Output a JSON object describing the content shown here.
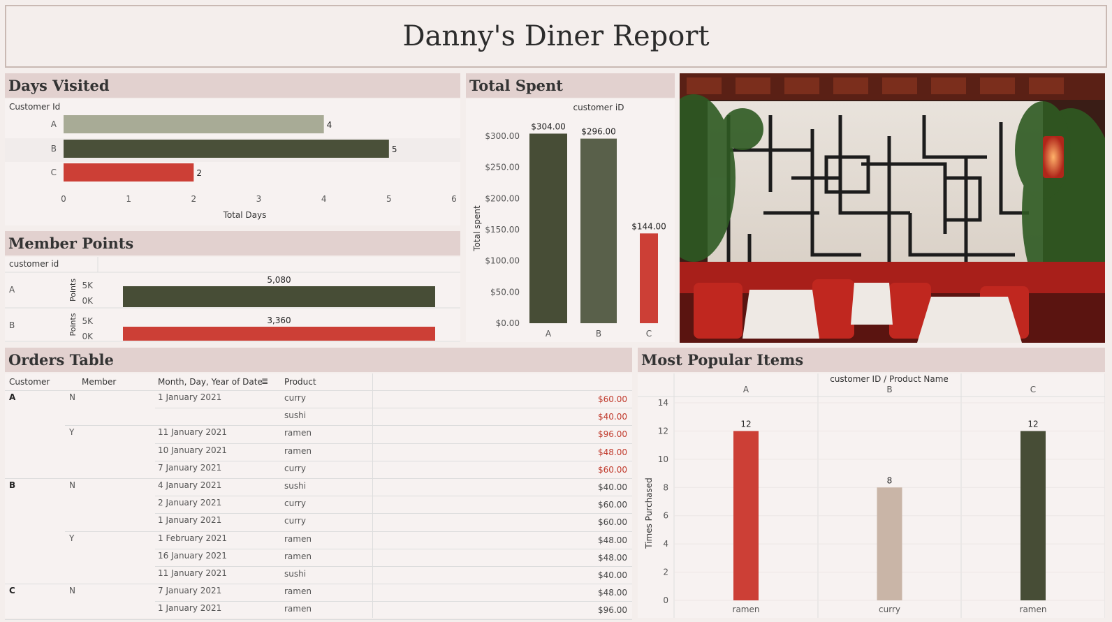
{
  "title": "Danny's Diner Report",
  "days_visited": {
    "header": "Days Visited",
    "row_header": "Customer Id",
    "xlabel": "Total Days",
    "xticks": [
      "0",
      "1",
      "2",
      "3",
      "4",
      "5",
      "6"
    ],
    "colors": [
      "#a8ab96",
      "#4a5039",
      "#cc3f36"
    ]
  },
  "total_spent": {
    "header": "Total Spent",
    "top_label": "customer iD",
    "ylabel": "Total spent",
    "yticks": [
      "$0.00",
      "$50.00",
      "$100.00",
      "$150.00",
      "$200.00",
      "$250.00",
      "$300.00"
    ],
    "colors": [
      "#474d36",
      "#59604a",
      "#cc3f36"
    ]
  },
  "member_points": {
    "header": "Member Points",
    "col_header": "customer id",
    "axis_label": "Points",
    "ticks": [
      "5K",
      "0K"
    ],
    "colors": [
      "#474d36",
      "#cc3f36"
    ]
  },
  "orders_table": {
    "header": "Orders Table",
    "columns": [
      "Customer",
      "Member",
      "Month, Day, Year of Date",
      "Product"
    ],
    "member_price_color": "#c0392b",
    "rows": [
      {
        "customer": "A",
        "member": "N",
        "date": "1 January 2021",
        "product": "curry",
        "price": "$60.00",
        "red": true
      },
      {
        "customer": "",
        "member": "",
        "date": "",
        "product": "sushi",
        "price": "$40.00",
        "red": true
      },
      {
        "customer": "",
        "member": "Y",
        "date": "11 January 2021",
        "product": "ramen",
        "price": "$96.00",
        "red": true
      },
      {
        "customer": "",
        "member": "",
        "date": "10 January 2021",
        "product": "ramen",
        "price": "$48.00",
        "red": true
      },
      {
        "customer": "",
        "member": "",
        "date": "7 January 2021",
        "product": "curry",
        "price": "$60.00",
        "red": true
      },
      {
        "customer": "B",
        "member": "N",
        "date": "4 January 2021",
        "product": "sushi",
        "price": "$40.00",
        "red": false
      },
      {
        "customer": "",
        "member": "",
        "date": "2 January 2021",
        "product": "curry",
        "price": "$60.00",
        "red": false
      },
      {
        "customer": "",
        "member": "",
        "date": "1 January 2021",
        "product": "curry",
        "price": "$60.00",
        "red": false
      },
      {
        "customer": "",
        "member": "Y",
        "date": "1 February 2021",
        "product": "ramen",
        "price": "$48.00",
        "red": false
      },
      {
        "customer": "",
        "member": "",
        "date": "16 January 2021",
        "product": "ramen",
        "price": "$48.00",
        "red": false
      },
      {
        "customer": "",
        "member": "",
        "date": "11 January 2021",
        "product": "sushi",
        "price": "$40.00",
        "red": false
      },
      {
        "customer": "C",
        "member": "N",
        "date": "7 January 2021",
        "product": "ramen",
        "price": "$48.00",
        "red": false
      },
      {
        "customer": "",
        "member": "",
        "date": "1 January 2021",
        "product": "ramen",
        "price": "$96.00",
        "red": false
      }
    ]
  },
  "popular_items": {
    "header": "Most Popular Items",
    "top_label": "customer ID  /  Product Name",
    "ylabel": "Times Purchased",
    "yticks": [
      "0",
      "2",
      "4",
      "6",
      "8",
      "10",
      "12",
      "14"
    ],
    "colors": [
      "#cc3f36",
      "#c9b5a7",
      "#474d36"
    ]
  },
  "photo": {
    "description_icon": "restaurant-photo"
  },
  "chart_data": [
    {
      "type": "bar",
      "orientation": "horizontal",
      "title": "Days Visited",
      "categories": [
        "A",
        "B",
        "C"
      ],
      "values": [
        4,
        5,
        2
      ],
      "xlabel": "Total Days",
      "ylabel": "Customer Id",
      "xlim": [
        0,
        6
      ]
    },
    {
      "type": "bar",
      "title": "Total Spent",
      "categories": [
        "A",
        "B",
        "C"
      ],
      "values": [
        304,
        296,
        144
      ],
      "value_labels": [
        "$304.00",
        "$296.00",
        "$144.00"
      ],
      "xlabel": "customer iD",
      "ylabel": "Total spent",
      "ylim": [
        0,
        320
      ]
    },
    {
      "type": "bar",
      "orientation": "horizontal",
      "title": "Member Points",
      "categories": [
        "A",
        "B"
      ],
      "values": [
        5080,
        3360
      ],
      "value_labels": [
        "5,080",
        "3,360"
      ],
      "ylabel": "customer id",
      "xlabel": "Points"
    },
    {
      "type": "bar",
      "title": "Most Popular Items",
      "groups": [
        "A",
        "B",
        "C"
      ],
      "categories": [
        "ramen",
        "curry",
        "ramen"
      ],
      "values": [
        12,
        8,
        12
      ],
      "xlabel": "customer ID  /  Product Name",
      "ylabel": "Times Purchased",
      "ylim": [
        0,
        14
      ]
    }
  ]
}
